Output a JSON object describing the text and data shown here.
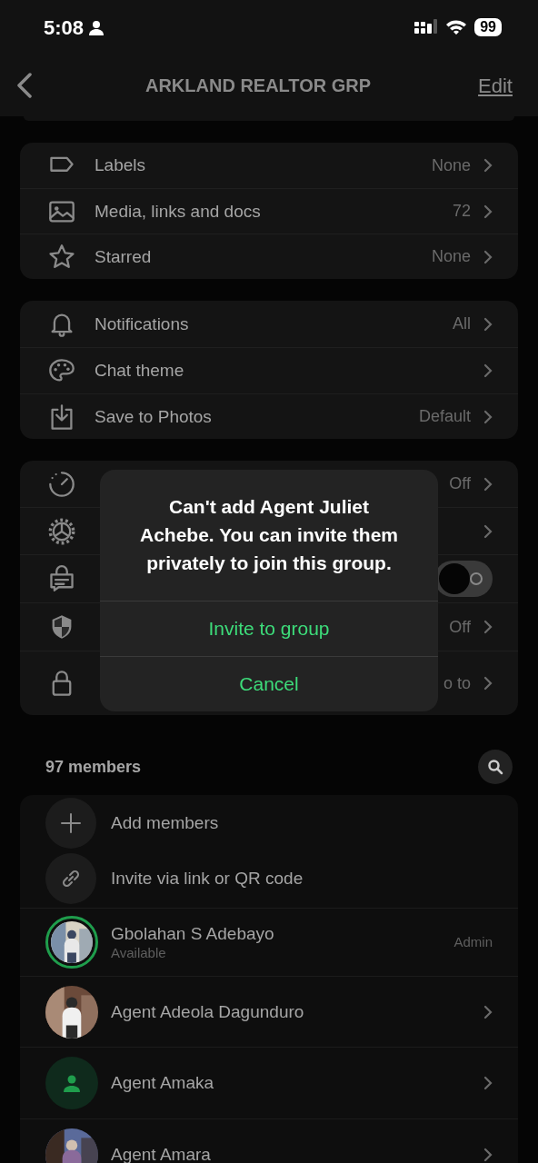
{
  "status_bar": {
    "time": "5:08",
    "battery": "99"
  },
  "nav": {
    "title": "ARKLAND REALTOR GRP",
    "edit": "Edit"
  },
  "sections": [
    {
      "rows": [
        {
          "label": "Labels",
          "value": "None"
        },
        {
          "label": "Media, links and docs",
          "value": "72"
        },
        {
          "label": "Starred",
          "value": "None"
        }
      ]
    },
    {
      "rows": [
        {
          "label": "Notifications",
          "value": "All"
        },
        {
          "label": "Chat theme"
        },
        {
          "label": "Save to Photos",
          "value": "Default"
        }
      ]
    },
    {
      "rows": [
        {
          "kind": "chevron",
          "value": "Off"
        },
        {
          "kind": "chevron"
        },
        {
          "kind": "toggle",
          "on": false
        },
        {
          "kind": "chevron",
          "value": "Off"
        },
        {
          "kind": "chevron",
          "value": "o to"
        }
      ]
    }
  ],
  "members": {
    "count": "97 members",
    "actions": [
      {
        "label": "Add members"
      },
      {
        "label": "Invite via link or QR code"
      }
    ],
    "list": [
      {
        "name": "Gbolahan S Adebayo",
        "status": "Available",
        "role": "Admin",
        "kind": "picture",
        "story_ring": true
      },
      {
        "name": "Agent Adeola Dagunduro",
        "kind": "picture",
        "story_ring": false
      },
      {
        "name": "Agent Amaka",
        "kind": "placeholder",
        "story_ring": false
      },
      {
        "name": "Agent Amara",
        "kind": "picture",
        "story_ring": false
      }
    ]
  },
  "dialog": {
    "message": "Can't add Agent Juliet Achebe. You can invite them privately to join this group.",
    "buttons": [
      "Invite to group",
      "Cancel"
    ]
  }
}
